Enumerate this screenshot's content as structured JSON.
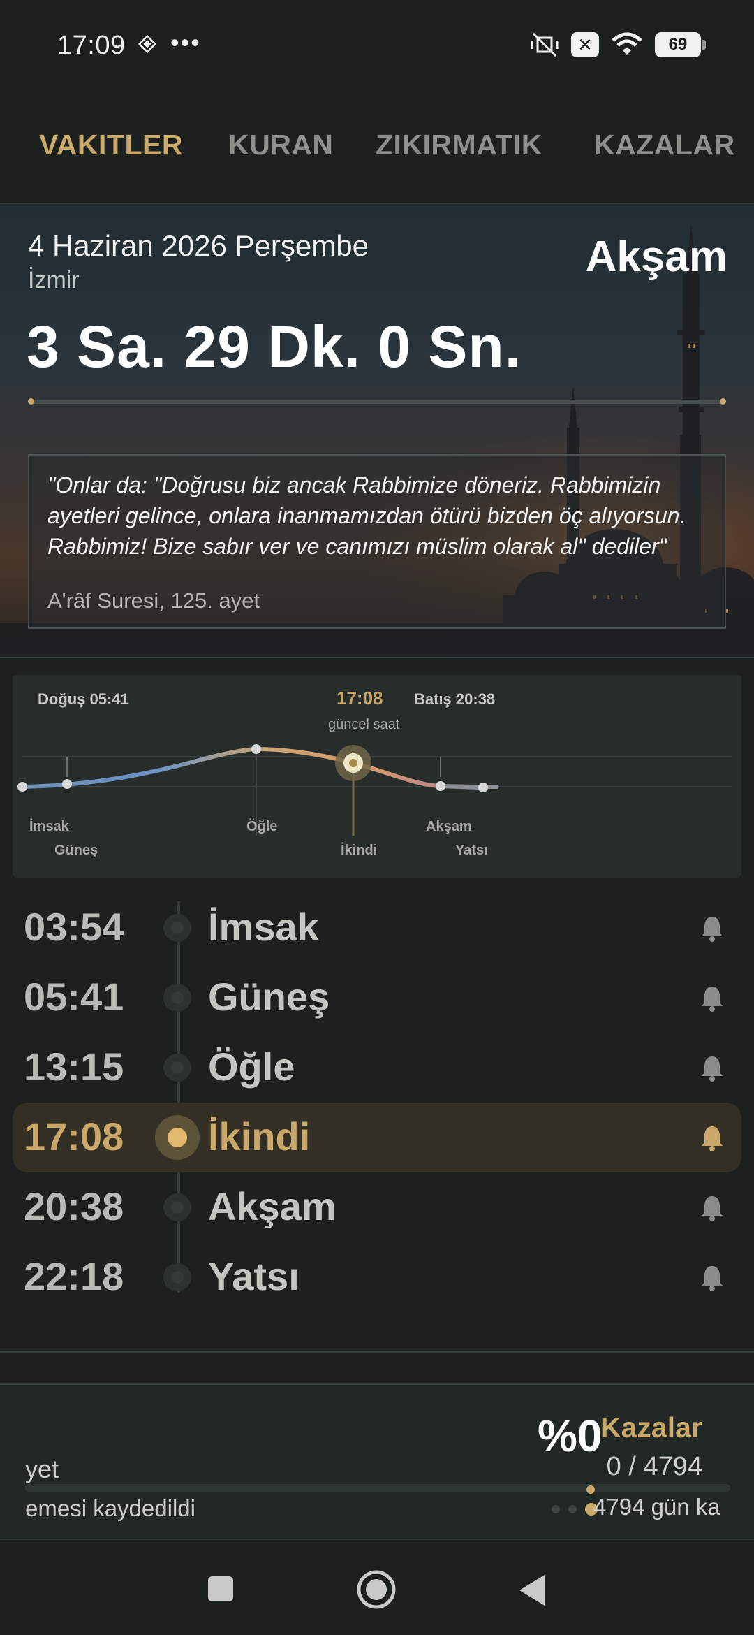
{
  "status_bar": {
    "time": "17:09",
    "dots": "•••",
    "battery": "69",
    "x_badge": "✕"
  },
  "tabs": [
    {
      "label": "VAKITLER",
      "active": true
    },
    {
      "label": "KURAN",
      "active": false
    },
    {
      "label": "ZIKIRMATIK",
      "active": false
    },
    {
      "label": "KAZALAR",
      "active": false
    }
  ],
  "hero": {
    "date": "4 Haziran 2026 Perşembe",
    "city": "İzmir",
    "next_prayer": "Akşam",
    "countdown": "3 Sa. 29 Dk. 0 Sn.",
    "progress": 0.0,
    "quote": "\"Onlar da: \"Doğrusu biz ancak Rabbimize döneriz. Rabbimizin ayetleri gelince, onlara inanmamızdan ötürü bizden öç alıyorsun. Rabbimiz! Bize sabır ver ve canımızı müslim olarak al\" dediler\"",
    "quote_source": "A'râf Suresi, 125. ayet"
  },
  "timeline": {
    "sunrise_label": "Doğuş 05:41",
    "sunset_label": "Batış 20:38",
    "current_time": "17:08",
    "current_label": "güncel saat",
    "points": [
      "İmsak",
      "Güneş",
      "Öğle",
      "İkindi",
      "Akşam",
      "Yatsı"
    ]
  },
  "prayers": [
    {
      "time": "03:54",
      "name": "İmsak",
      "active": false
    },
    {
      "time": "05:41",
      "name": "Güneş",
      "active": false
    },
    {
      "time": "13:15",
      "name": "Öğle",
      "active": false
    },
    {
      "time": "17:08",
      "name": "İkindi",
      "active": true
    },
    {
      "time": "20:38",
      "name": "Akşam",
      "active": false
    },
    {
      "time": "22:18",
      "name": "Yatsı",
      "active": false
    }
  ],
  "kaza_card": {
    "percent": "%0",
    "title": "Kazalar",
    "count": "0 / 4794",
    "left_line1": "yet",
    "left_line2": "emesi kaydedildi",
    "days": "4794 gün ka",
    "progress": 0.0
  },
  "colors": {
    "accent": "#c9a86a",
    "background": "#1c211f"
  },
  "nav": {
    "icons": [
      "square-recents-icon",
      "circle-home-icon",
      "triangle-back-icon"
    ]
  }
}
